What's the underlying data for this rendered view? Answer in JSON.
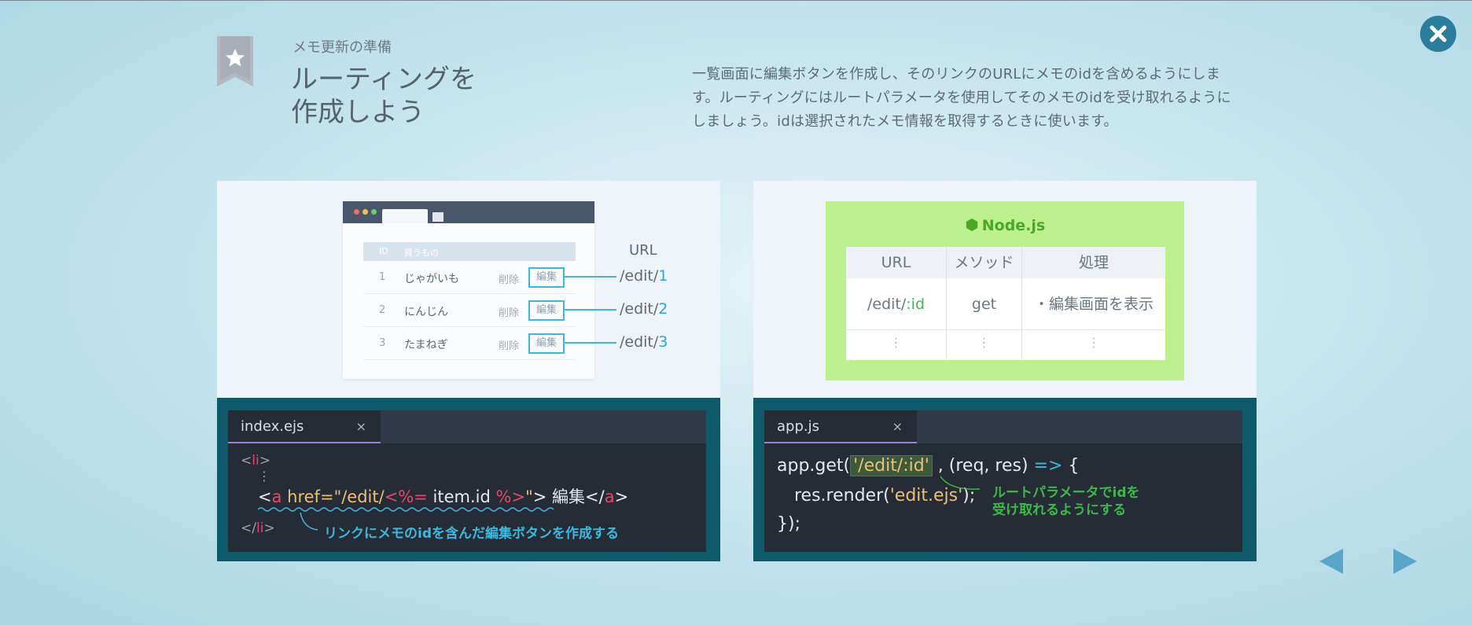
{
  "header": {
    "subtitle": "メモ更新の準備",
    "title_line1": "ルーティングを",
    "title_line2": "作成しよう",
    "description": "一覧画面に編集ボタンを作成し、そのリンクのURLにメモのidを含めるようにします。ルーティングにはルートパラメータを使用してそのメモのidを受け取れるようにしましょう。idは選択されたメモ情報を取得するときに使います。"
  },
  "browser_mock": {
    "col_id": "ID",
    "col_name": "買うもの",
    "rows": [
      {
        "id": "1",
        "name": "じゃがいも",
        "delete": "削除",
        "edit": "編集"
      },
      {
        "id": "2",
        "name": "にんじん",
        "delete": "削除",
        "edit": "編集"
      },
      {
        "id": "3",
        "name": "たまねぎ",
        "delete": "削除",
        "edit": "編集"
      }
    ],
    "url_label": "URL",
    "url_prefix": "/edit/",
    "url_ids": [
      "1",
      "2",
      "3"
    ]
  },
  "node_box": {
    "title": "Node.js",
    "headers": [
      "URL",
      "メソッド",
      "処理"
    ],
    "row": {
      "url_prefix": "/edit/",
      "url_param": ":id",
      "method": "get",
      "action": "・編集画面を表示"
    },
    "ellipsis": "⋮"
  },
  "left_editor": {
    "tab": "index.ejs",
    "tab_close": "×",
    "line1_open": "<",
    "line1_tag": "li",
    "line1_close": ">",
    "ellipsis": "⋮",
    "a_open": "<",
    "a_tag": "a",
    "a_attr": " href=",
    "a_q1": "\"/edit/",
    "a_ejs_open": "<%=",
    "a_expr": " item.id ",
    "a_ejs_close": "%>",
    "a_q2": "\"",
    "a_gt": "> 編集</",
    "a_tag_end": "a",
    "a_gt2": ">",
    "line3_open": "</",
    "line3_tag": "li",
    "line3_close": ">",
    "annotation": "リンクにメモのidを含んだ編集ボタンを作成する"
  },
  "right_editor": {
    "tab": "app.js",
    "tab_close": "×",
    "line1_a": "app.get(",
    "line1_path": "'/edit/:id'",
    "line1_b": " , (req, res) ",
    "line1_arrow": "=>",
    "line1_c": " {",
    "line2_a": "res.render(",
    "line2_str": "'edit.ejs'",
    "line2_b": ");",
    "line3": "});",
    "annotation_line1": "ルートパラメータでidを",
    "annotation_line2": "受け取れるようにする"
  },
  "colors": {
    "accent_blue": "#3cb8df",
    "close_button": "#2c7d9c",
    "node_green": "#bdf08e",
    "code_bg": "#262c36"
  }
}
